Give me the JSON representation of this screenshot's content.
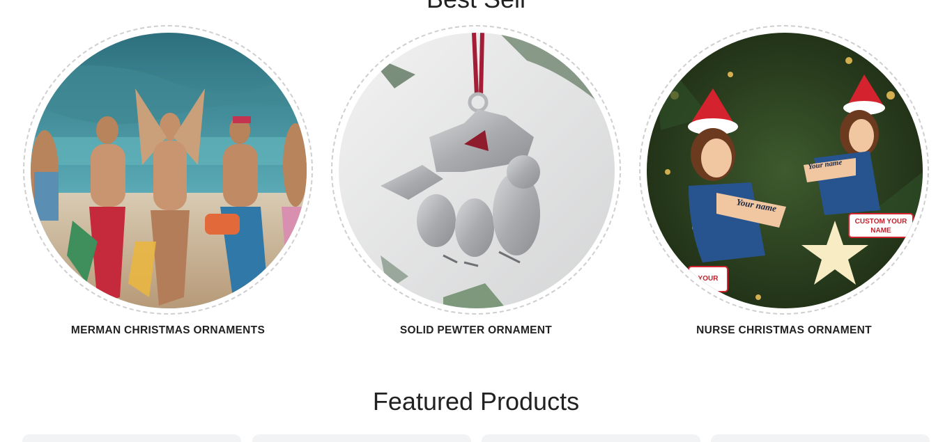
{
  "best_sell": {
    "title": "Best Sell",
    "categories": [
      {
        "label": "MERMAN CHRISTMAS ORNAMENTS",
        "image": "merman-ornaments-photo"
      },
      {
        "label": "SOLID PEWTER ORNAMENT",
        "image": "pewter-ornament-photo"
      },
      {
        "label": "NURSE CHRISTMAS ORNAMENT",
        "image": "nurse-ornament-photo"
      }
    ],
    "image_text": {
      "your_name_1": "Your name",
      "your_name_2": "Your name",
      "custom_your": "CUSTOM YOUR",
      "name": "NAME",
      "your": "YOUR"
    }
  },
  "featured": {
    "title": "Featured Products",
    "card_count": 4
  },
  "colors": {
    "text": "#222222",
    "ring_border": "#cfcfcf",
    "card_bg": "#f2f3f5"
  }
}
